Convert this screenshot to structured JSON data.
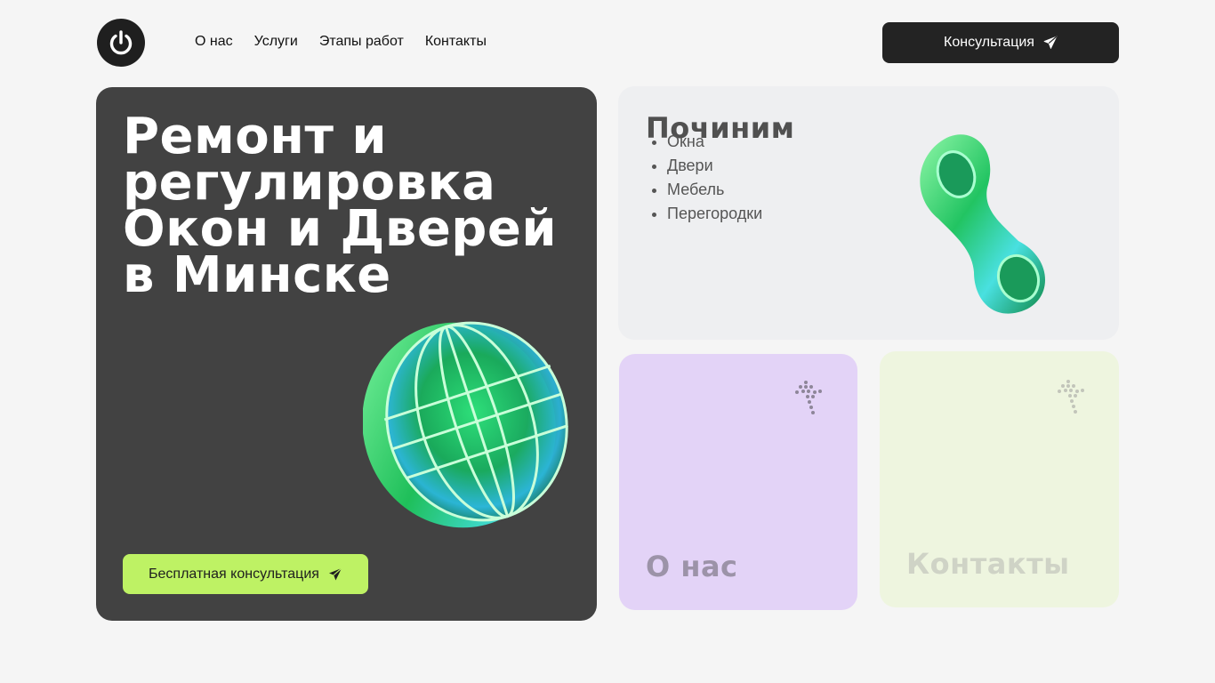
{
  "header": {
    "nav": [
      {
        "label": "О нас"
      },
      {
        "label": "Услуги"
      },
      {
        "label": "Этапы работ"
      },
      {
        "label": "Контакты"
      }
    ],
    "cta_label": "Консультация"
  },
  "hero": {
    "title_lines": [
      "Ремонт и",
      "регулировка",
      "Окон и Дверей",
      "в Минске"
    ],
    "cta_label": "Бесплатная консультация"
  },
  "repair": {
    "title": "Починим",
    "items": [
      "Окна",
      "Двери",
      "Мебель",
      "Перегородки"
    ]
  },
  "cards": {
    "about_label": "О нас",
    "contacts_label": "Контакты"
  },
  "colors": {
    "background": "#f5f5f5",
    "dark": "#232323",
    "hero_bg": "#424242",
    "accent_green": "#bef264",
    "repair_bg": "#eeeff1",
    "about_bg": "#e3d3f7",
    "contacts_bg": "#eef5df"
  },
  "icons": {
    "logo": "power-icon",
    "cta": "paper-plane-icon",
    "card_arrow": "dotted-arrow-up-right-icon",
    "hero_art": "globe-3d-icon",
    "repair_art": "chain-link-3d-icon"
  }
}
